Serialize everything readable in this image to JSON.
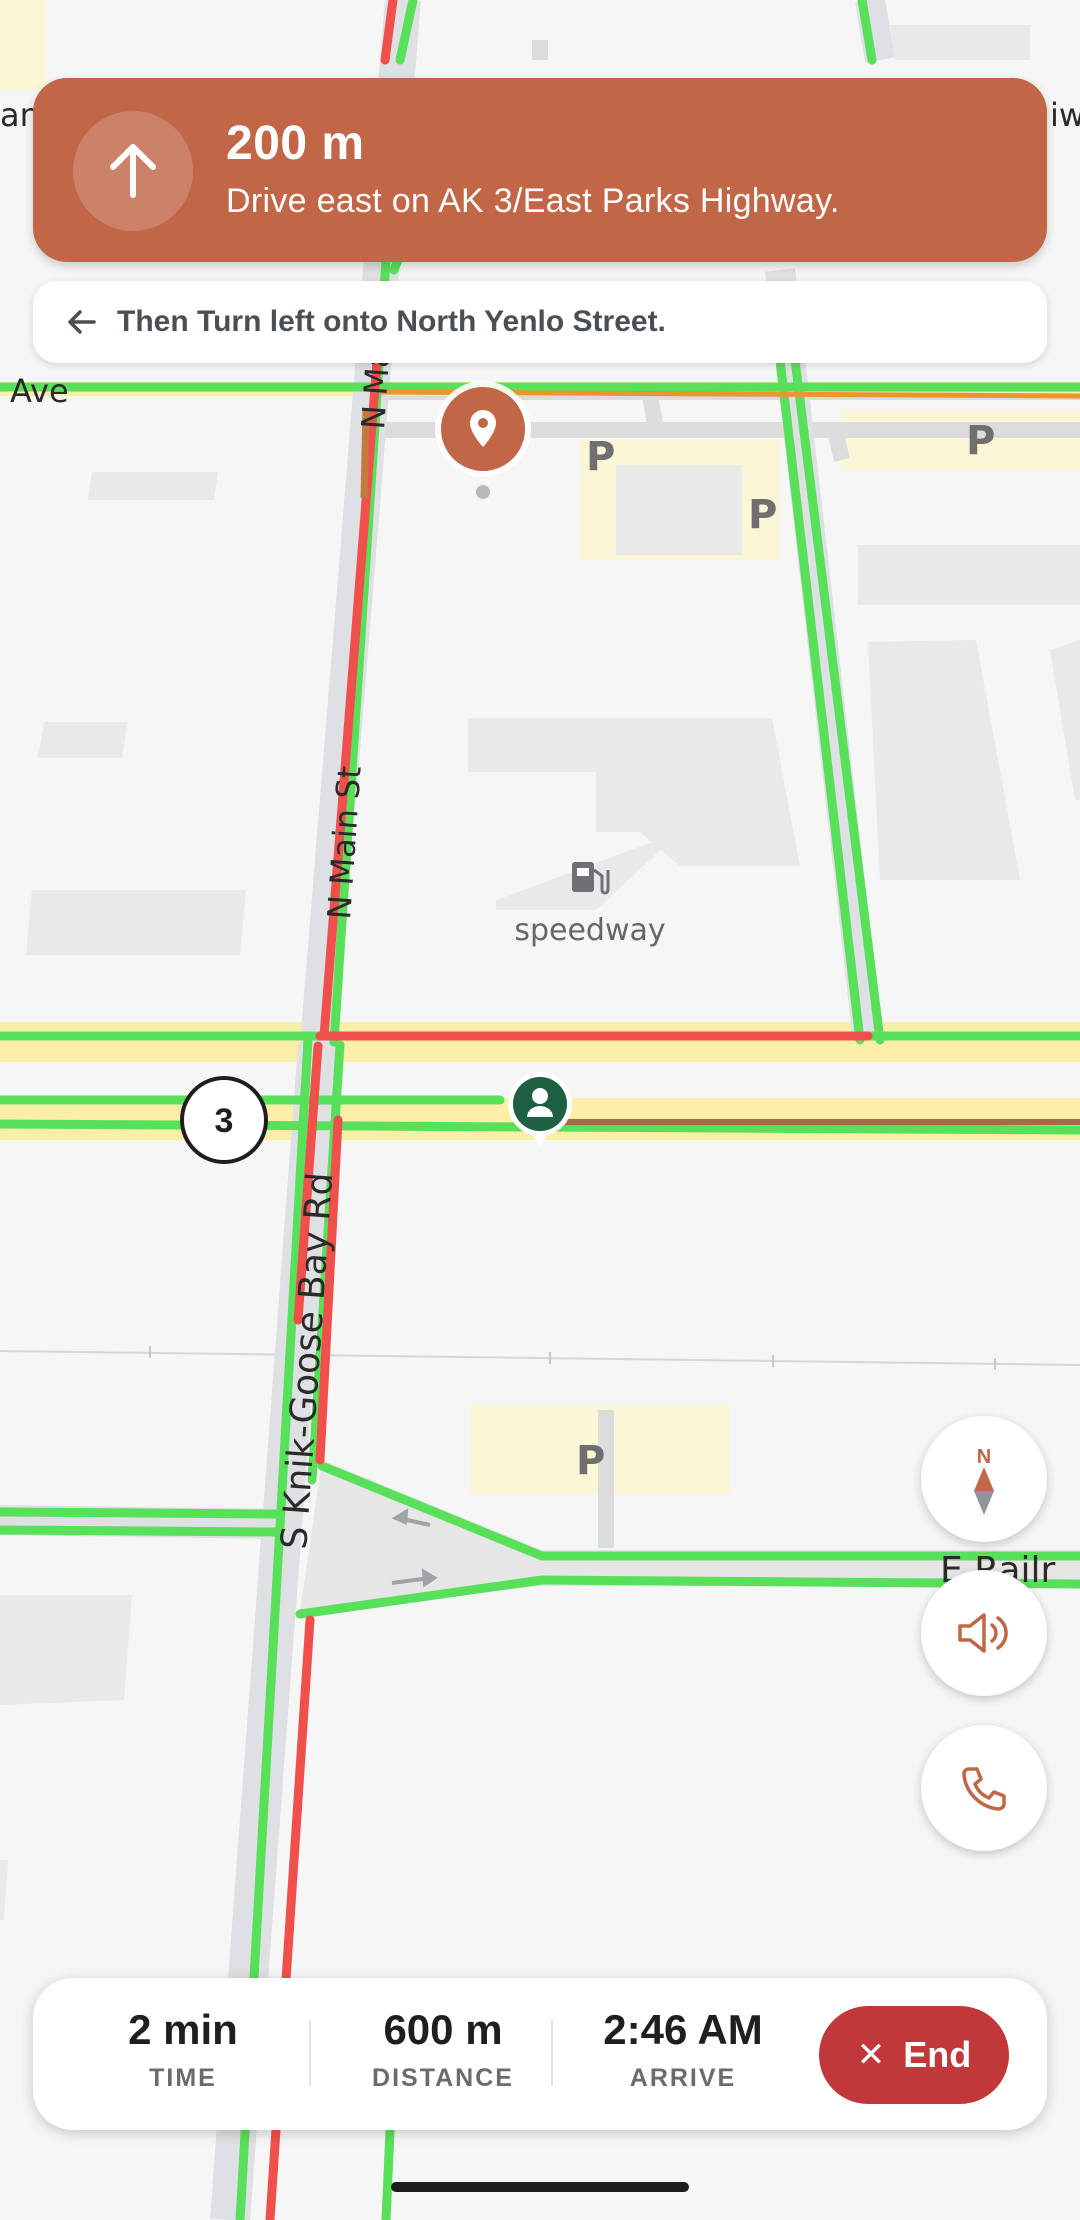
{
  "navigation": {
    "distance": "200 m",
    "instruction": "Drive east on AK 3/East Parks Highway.",
    "next_step": "Then Turn left onto North Yenlo Street.",
    "accent_color": "#c16747"
  },
  "map": {
    "labels": {
      "ave": "Ave",
      "n_main": "N Main St",
      "n_main_top": "N Ma",
      "knik": "S Knik-Goose Bay Rd",
      "railroad": "E Railr",
      "poi": "speedway",
      "route_shield": "3",
      "edge_left": "ans",
      "edge_right": "iwa",
      "parking": "P"
    }
  },
  "controls": {
    "compass_letter": "N",
    "sound_icon": "speaker-icon",
    "call_icon": "phone-icon"
  },
  "trip": {
    "time_value": "2 min",
    "time_label": "TIME",
    "distance_value": "600 m",
    "distance_label": "DISTANCE",
    "arrive_value": "2:46 AM",
    "arrive_label": "ARRIVE",
    "end_label": "End",
    "end_color": "#c0383a"
  }
}
